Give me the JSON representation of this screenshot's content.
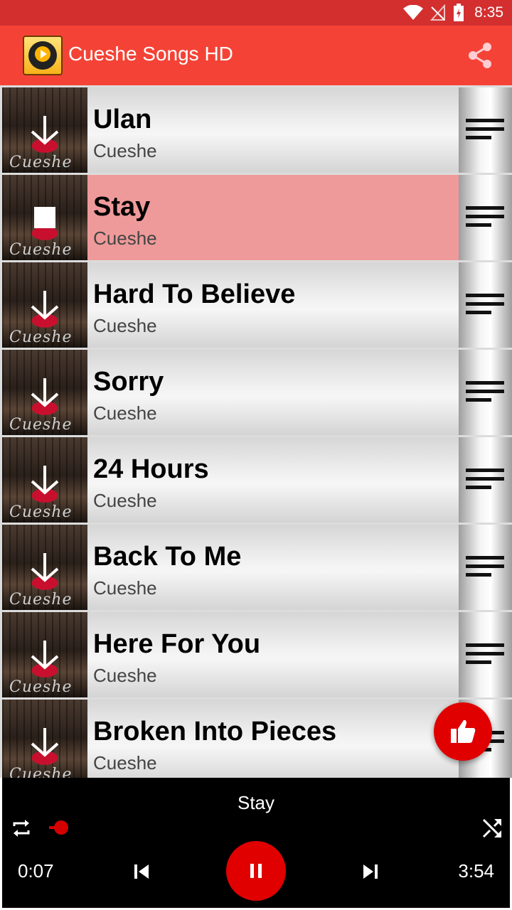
{
  "status_bar": {
    "time": "8:35"
  },
  "app_bar": {
    "title": "Cueshe Songs HD"
  },
  "songs": [
    {
      "title": "Ulan",
      "artist": "Cueshe",
      "state": "download",
      "thumb_text": "Cueshe"
    },
    {
      "title": "Stay",
      "artist": "Cueshe",
      "state": "stop",
      "thumb_text": "Cueshe"
    },
    {
      "title": "Hard To Believe",
      "artist": "Cueshe",
      "state": "download",
      "thumb_text": "Cueshe"
    },
    {
      "title": "Sorry",
      "artist": "Cueshe",
      "state": "download",
      "thumb_text": "Cueshe"
    },
    {
      "title": "24 Hours",
      "artist": "Cueshe",
      "state": "download",
      "thumb_text": "Cueshe"
    },
    {
      "title": "Back To Me",
      "artist": "Cueshe",
      "state": "download",
      "thumb_text": "Cueshe"
    },
    {
      "title": "Here For You",
      "artist": "Cueshe",
      "state": "download",
      "thumb_text": "Cueshe"
    },
    {
      "title": "Broken Into Pieces",
      "artist": "Cueshe",
      "state": "download",
      "thumb_text": "Cueshe"
    }
  ],
  "active_index": 1,
  "player": {
    "now_playing": "Stay",
    "elapsed": "0:07",
    "total": "3:54",
    "progress": 0.03
  },
  "colors": {
    "status_bar": "#d32f2f",
    "app_bar": "#f44336",
    "accent": "#e00000",
    "active_row": "#ef9a9a"
  },
  "icons": {
    "wifi": "wifi-icon",
    "signal": "signal-off-icon",
    "battery": "battery-icon",
    "share": "share-icon",
    "download": "download-icon",
    "stop": "stop-icon",
    "drag": "drag-handle-icon",
    "like": "thumbs-up-icon",
    "repeat": "repeat-icon",
    "shuffle": "shuffle-icon",
    "prev": "skip-previous-icon",
    "pause": "pause-icon",
    "next": "skip-next-icon"
  }
}
